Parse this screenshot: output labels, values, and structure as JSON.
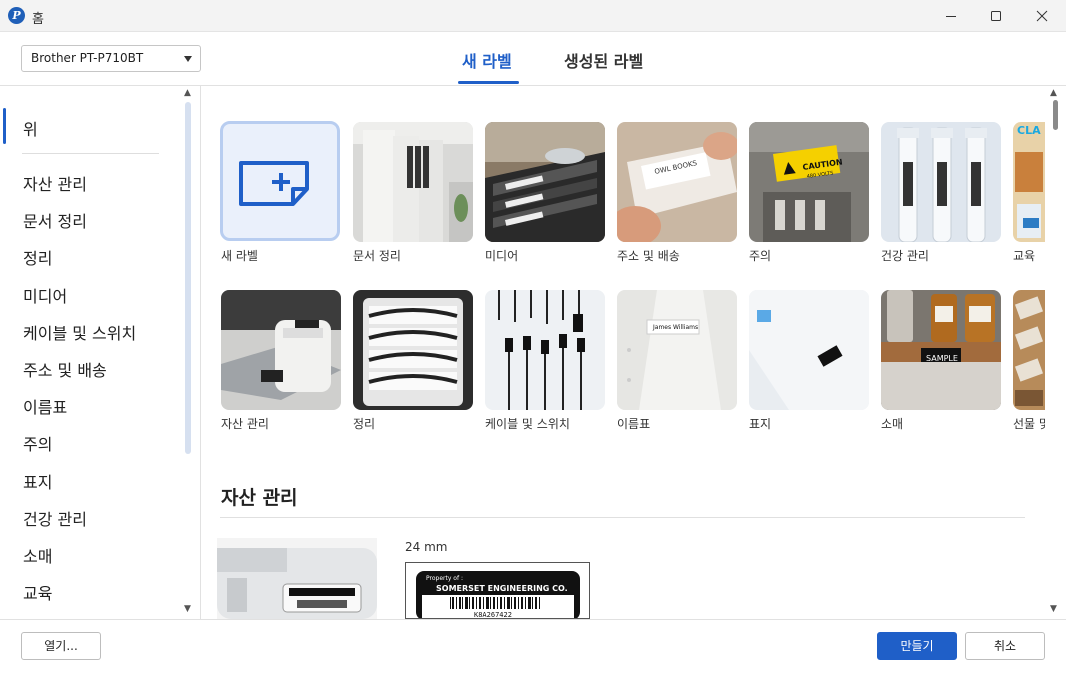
{
  "window": {
    "title": "홈",
    "app_icon_letter": "P"
  },
  "printer": {
    "selected": "Brother PT-P710BT"
  },
  "tabs": [
    {
      "label": "새 라벨",
      "active": true
    },
    {
      "label": "생성된 라벨",
      "active": false
    }
  ],
  "sidebar": {
    "items": [
      {
        "label": "위",
        "active": true
      },
      {
        "label": "자산 관리"
      },
      {
        "label": "문서 정리"
      },
      {
        "label": "정리"
      },
      {
        "label": "미디어"
      },
      {
        "label": "케이블 및 스위치"
      },
      {
        "label": "주소 및 배송"
      },
      {
        "label": "이름표"
      },
      {
        "label": "주의"
      },
      {
        "label": "표지"
      },
      {
        "label": "건강 관리"
      },
      {
        "label": "소매"
      },
      {
        "label": "교육"
      }
    ]
  },
  "gallery": {
    "row1": [
      {
        "label": "새 라벨",
        "icon": "new-label-icon"
      },
      {
        "label": "문서 정리"
      },
      {
        "label": "미디어"
      },
      {
        "label": "주소 및 배송",
        "photo_text": "OWL BOOKS"
      },
      {
        "label": "주의",
        "photo_text": "CAUTION",
        "photo_subtext": "480 VOLTS"
      },
      {
        "label": "건강 관리"
      },
      {
        "label": "교육",
        "photo_text": "CLA"
      }
    ],
    "row2": [
      {
        "label": "자산 관리"
      },
      {
        "label": "정리"
      },
      {
        "label": "케이블 및 스위치"
      },
      {
        "label": "이름표",
        "photo_text": "James Williams"
      },
      {
        "label": "표지"
      },
      {
        "label": "소매",
        "photo_text": "SAMPLE"
      },
      {
        "label": "선물 및"
      }
    ]
  },
  "section": {
    "title": "자산 관리",
    "tape_size": "24 mm",
    "preview": {
      "line1": "Property of :",
      "line2": "SOMERSET ENGINEERING CO.",
      "line3": "K8A267422"
    }
  },
  "footer": {
    "open_label": "열기...",
    "create_label": "만들기",
    "cancel_label": "취소"
  },
  "colors": {
    "accent": "#1f5fc8",
    "caution_yellow": "#f5d000"
  }
}
